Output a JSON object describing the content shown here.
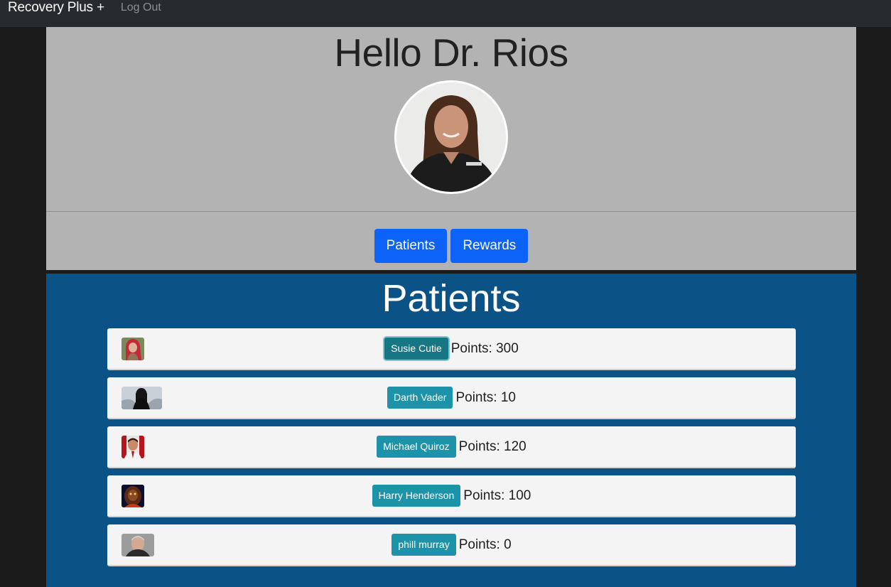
{
  "navbar": {
    "brand": "Recovery Plus +",
    "logout": "Log Out"
  },
  "profile": {
    "greeting": "Hello Dr. Rios",
    "buttons": {
      "patients": "Patients",
      "rewards": "Rewards"
    }
  },
  "patients": {
    "title": "Patients",
    "list": [
      {
        "name": "Susie Cutie",
        "points": "Points: 300",
        "selected": true
      },
      {
        "name": "Darth Vader",
        "points": "Points: 10",
        "selected": false
      },
      {
        "name": "Michael Quiroz",
        "points": "Points: 120",
        "selected": false
      },
      {
        "name": "Harry Henderson",
        "points": "Points: 100",
        "selected": false
      },
      {
        "name": "phill murray",
        "points": "Points: 0",
        "selected": false
      }
    ]
  },
  "colors": {
    "navbar": "#272b30",
    "profile_bg": "#b3b3b3",
    "primary_button": "#0d62f7",
    "patients_bg": "#0b5287",
    "name_button": "#1c93a8"
  }
}
